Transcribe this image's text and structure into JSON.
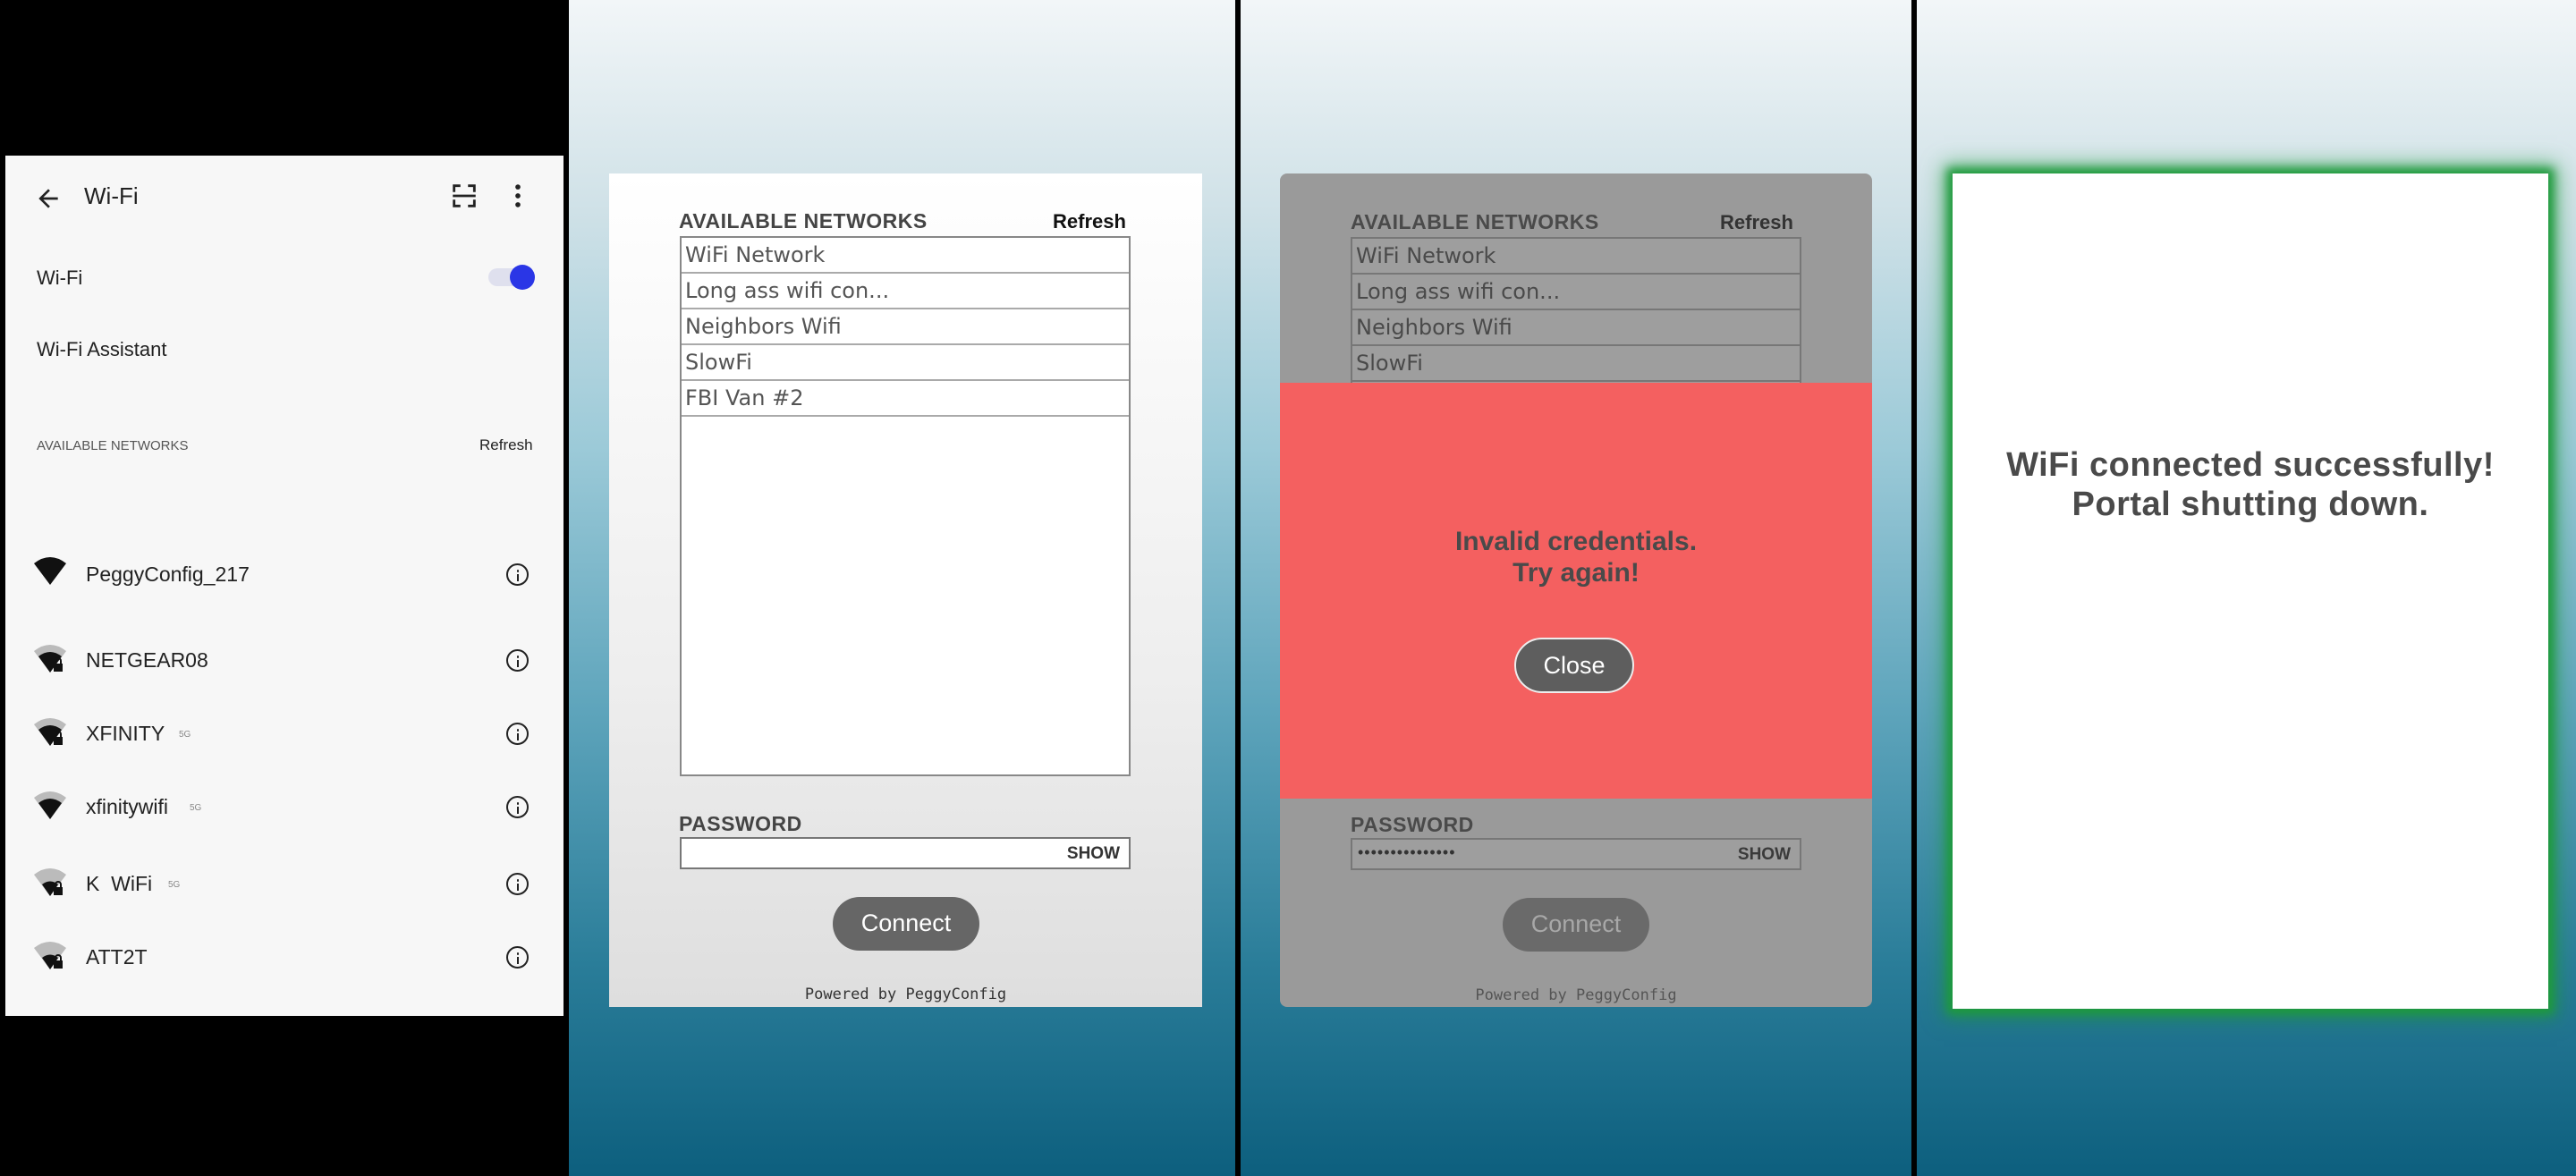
{
  "settings": {
    "title": "Wi-Fi",
    "wifi_toggle_label": "Wi-Fi",
    "wifi_toggle_on": true,
    "assistant_label": "Wi-Fi Assistant",
    "available_header": "AVAILABLE NETWORKS",
    "refresh_label": "Refresh",
    "networks": [
      {
        "name": "PeggyConfig_217",
        "badge": "",
        "signal": "full",
        "icon": "wifi-full-icon"
      },
      {
        "name": "NETGEAR08",
        "badge": "",
        "signal": "lock",
        "icon": "wifi-lock-icon"
      },
      {
        "name": "XFINITY",
        "badge": "5G",
        "signal": "lock",
        "icon": "wifi-lock-icon"
      },
      {
        "name": "xfinitywifi",
        "badge": "5G",
        "signal": "medium",
        "icon": "wifi-medium-icon"
      },
      {
        "name": "K  WiFi",
        "badge": "5G",
        "signal": "lock-weak",
        "icon": "wifi-lock-icon"
      },
      {
        "name": "ATT2T",
        "badge": "",
        "signal": "lock-weak",
        "icon": "wifi-lock-icon"
      }
    ],
    "accent_color": "#2a36e6"
  },
  "portal": {
    "available_header": "AVAILABLE NETWORKS",
    "refresh_label": "Refresh",
    "networks": [
      "WiFi Network",
      "Long ass wifi con...",
      "Neighbors Wifi",
      "SlowFi",
      "FBI Van #2"
    ],
    "password_label": "PASSWORD",
    "show_label": "SHOW",
    "connect_label": "Connect",
    "powered_by": "Powered by PeggyConfig"
  },
  "error_portal": {
    "networks": [
      "WiFi Network",
      "Long ass wifi con...",
      "Neighbors Wifi",
      "SlowFi"
    ],
    "password_value": "•••••••••••••••",
    "error_line1": "Invalid credentials.",
    "error_line2": "Try again!",
    "close_label": "Close",
    "error_color": "#f46060"
  },
  "success": {
    "line1": "WiFi connected successfully!",
    "line2": "Portal shutting down.",
    "glow_color": "#1e9a3c"
  }
}
